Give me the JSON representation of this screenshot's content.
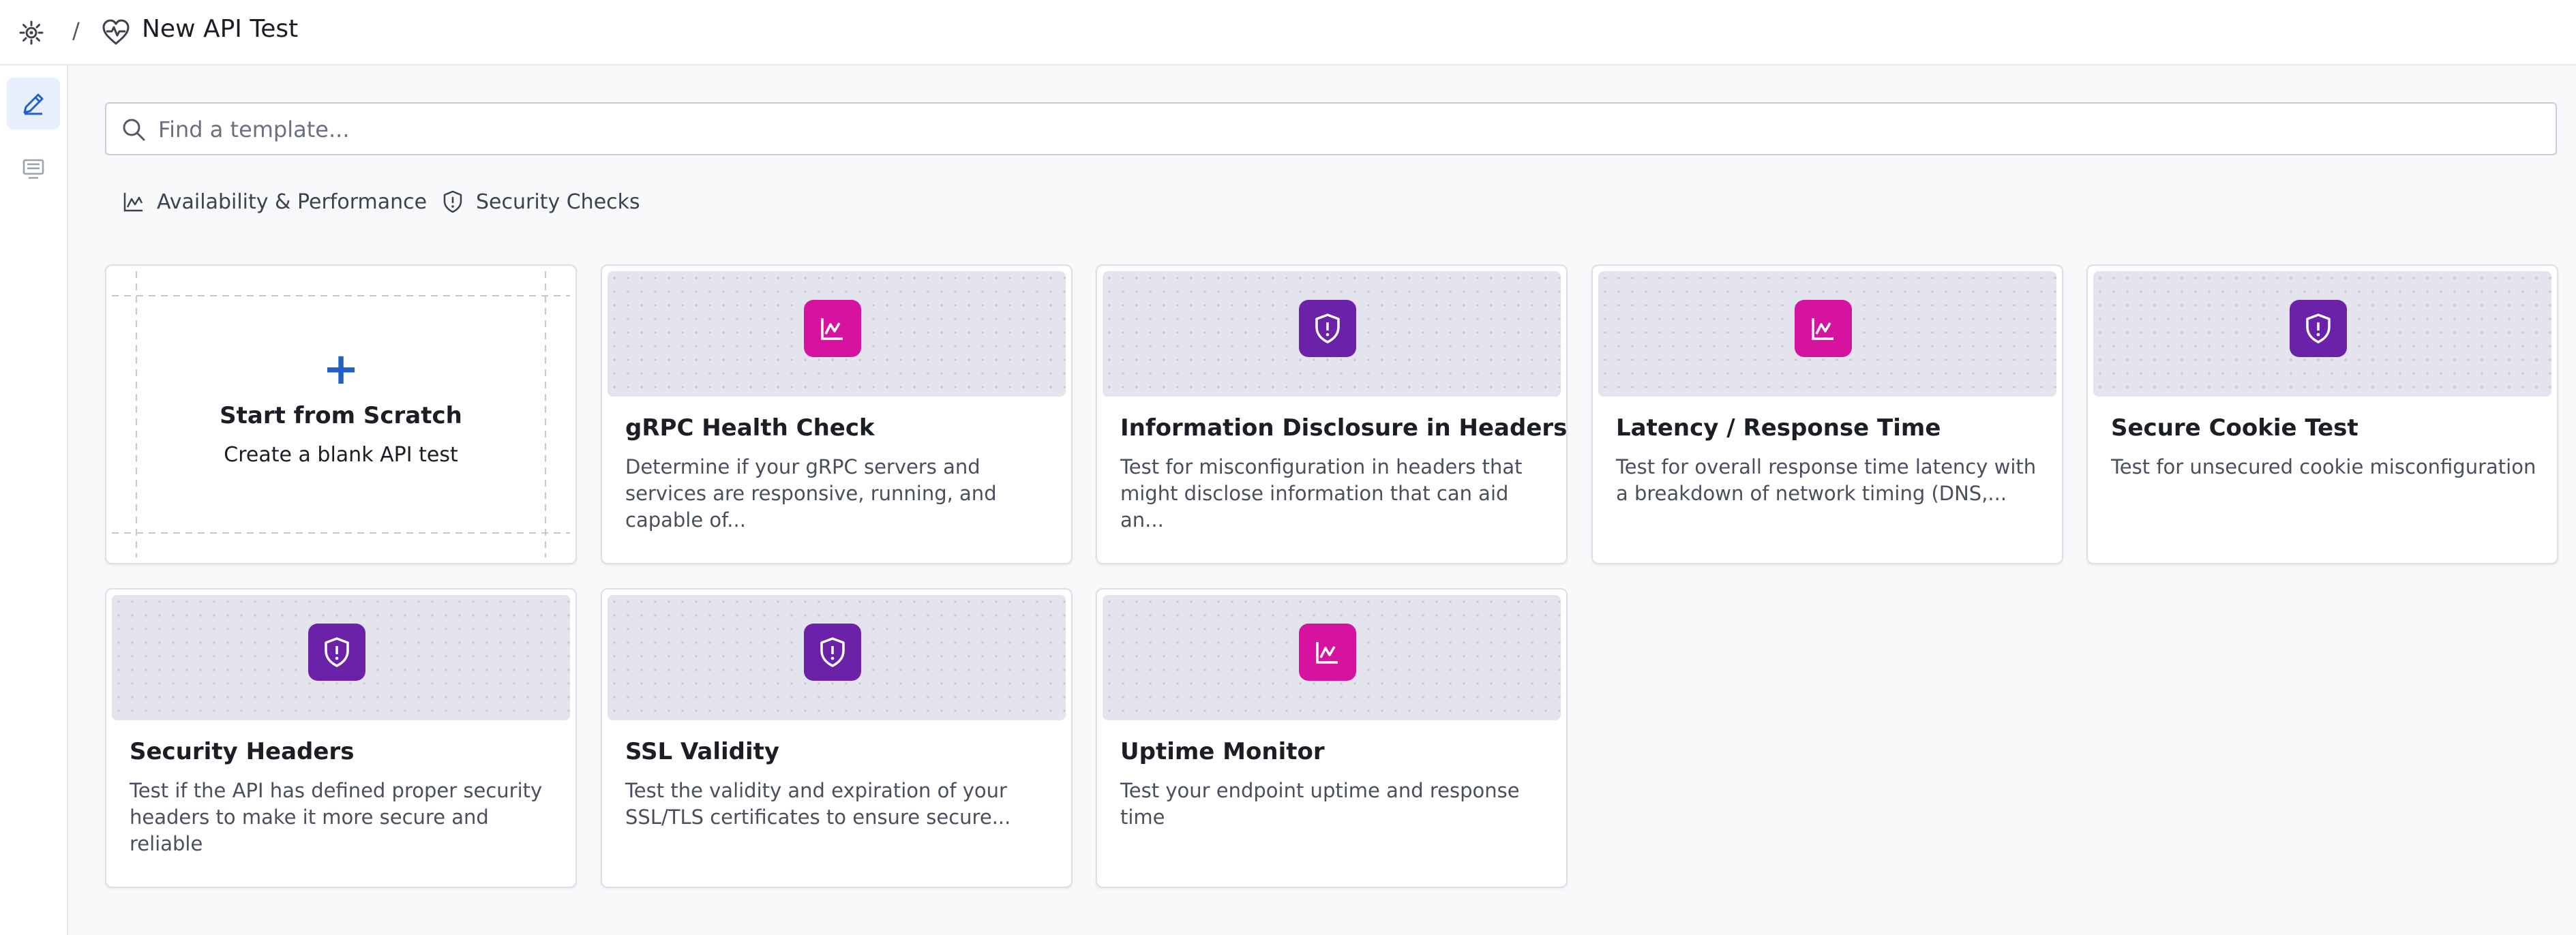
{
  "header": {
    "separator": "/",
    "title": "New API Test"
  },
  "search": {
    "placeholder": "Find a template...",
    "value": ""
  },
  "filters": [
    {
      "label": "Availability & Performance",
      "icon": "chart-icon"
    },
    {
      "label": "Security Checks",
      "icon": "shield-icon"
    }
  ],
  "scratch": {
    "plus": "+",
    "title": "Start from Scratch",
    "description": "Create a blank API test"
  },
  "templates": [
    {
      "title": "gRPC Health Check",
      "description": "Determine if your gRPC servers and services are responsive, running, and capable of...",
      "category": "performance"
    },
    {
      "title": "Information Disclosure in Headers",
      "description": "Test for misconfiguration in headers that might disclose information that can aid an...",
      "category": "security"
    },
    {
      "title": "Latency / Response Time",
      "description": "Test for overall response time latency with a breakdown of network timing (DNS,...",
      "category": "performance"
    },
    {
      "title": "Secure Cookie Test",
      "description": "Test for unsecured cookie misconfiguration",
      "category": "security"
    },
    {
      "title": "Security Headers",
      "description": "Test if the API has defined proper security headers to make it more secure and reliable",
      "category": "security"
    },
    {
      "title": "SSL Validity",
      "description": "Test the validity and expiration of your SSL/TLS certificates to ensure secure...",
      "category": "security"
    },
    {
      "title": "Uptime Monitor",
      "description": "Test your endpoint uptime and response time",
      "category": "performance"
    }
  ],
  "colors": {
    "performance": "#d5139e",
    "security": "#6b21a8",
    "accent": "#2160c4"
  }
}
